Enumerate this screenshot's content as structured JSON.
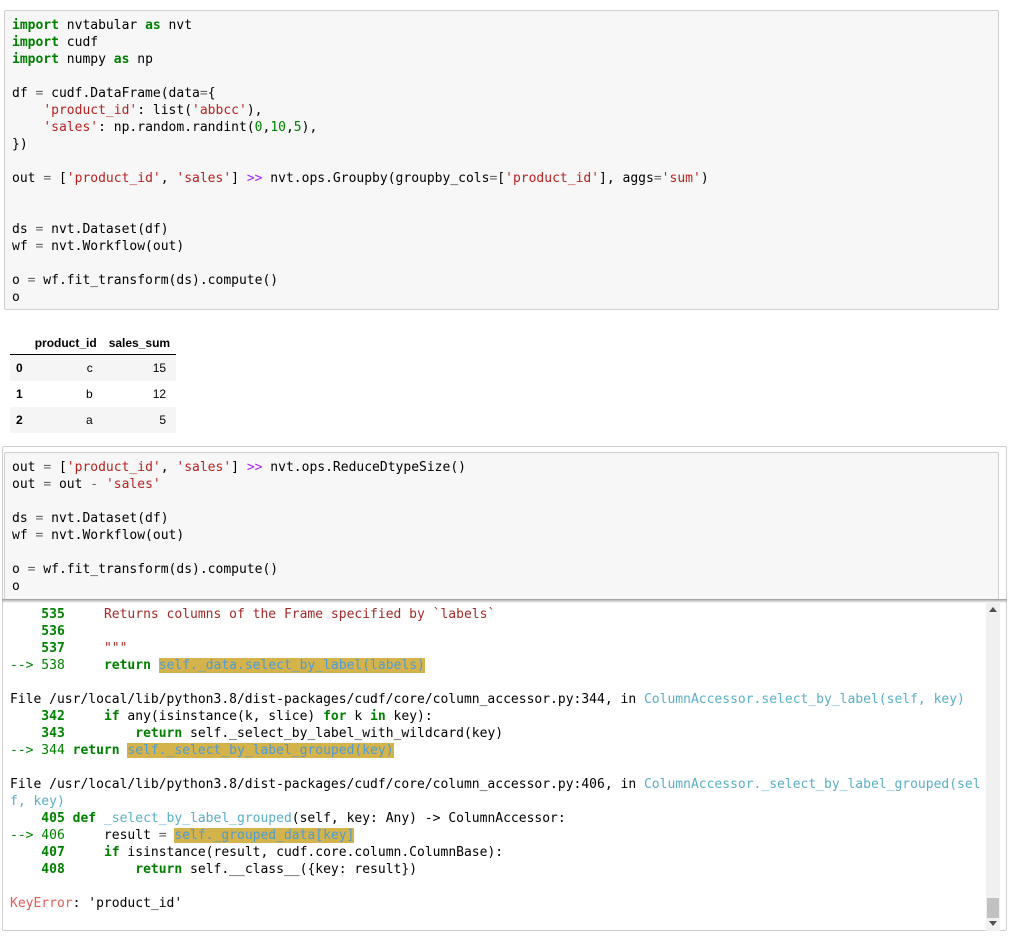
{
  "cell1": {
    "lines": [
      [
        [
          "kw",
          "import"
        ],
        [
          "t",
          " nvtabular "
        ],
        [
          "kw",
          "as"
        ],
        [
          "t",
          " nvt"
        ]
      ],
      [
        [
          "kw",
          "import"
        ],
        [
          "t",
          " cudf"
        ]
      ],
      [
        [
          "kw",
          "import"
        ],
        [
          "t",
          " numpy "
        ],
        [
          "kw",
          "as"
        ],
        [
          "t",
          " np"
        ]
      ],
      [],
      [
        [
          "t",
          "df "
        ],
        [
          "eq",
          "="
        ],
        [
          "t",
          " cudf.DataFrame(data"
        ],
        [
          "eq",
          "="
        ],
        [
          "t",
          "{"
        ]
      ],
      [
        [
          "t",
          "    "
        ],
        [
          "str",
          "'product_id'"
        ],
        [
          "t",
          ": list("
        ],
        [
          "str",
          "'abbcc'"
        ],
        [
          "t",
          "),"
        ]
      ],
      [
        [
          "t",
          "    "
        ],
        [
          "str",
          "'sales'"
        ],
        [
          "t",
          ": np.random.randint("
        ],
        [
          "num",
          "0"
        ],
        [
          "t",
          ","
        ],
        [
          "num",
          "10"
        ],
        [
          "t",
          ","
        ],
        [
          "num",
          "5"
        ],
        [
          "t",
          "),"
        ]
      ],
      [
        [
          "t",
          "})"
        ]
      ],
      [],
      [
        [
          "t",
          "out "
        ],
        [
          "eq",
          "="
        ],
        [
          "t",
          " ["
        ],
        [
          "str",
          "'product_id'"
        ],
        [
          "t",
          ", "
        ],
        [
          "str",
          "'sales'"
        ],
        [
          "t",
          "] "
        ],
        [
          "op",
          ">>"
        ],
        [
          "t",
          " nvt.ops.Groupby(groupby_cols"
        ],
        [
          "eq",
          "="
        ],
        [
          "t",
          "["
        ],
        [
          "str",
          "'product_id'"
        ],
        [
          "t",
          "], aggs"
        ],
        [
          "eq",
          "="
        ],
        [
          "str",
          "'sum'"
        ],
        [
          "t",
          ")"
        ]
      ],
      [],
      [],
      [
        [
          "t",
          "ds "
        ],
        [
          "eq",
          "="
        ],
        [
          "t",
          " nvt.Dataset(df)"
        ]
      ],
      [
        [
          "t",
          "wf "
        ],
        [
          "eq",
          "="
        ],
        [
          "t",
          " nvt.Workflow(out)"
        ]
      ],
      [],
      [
        [
          "t",
          "o "
        ],
        [
          "eq",
          "="
        ],
        [
          "t",
          " wf.fit_transform(ds).compute()"
        ]
      ],
      [
        [
          "t",
          "o"
        ]
      ]
    ]
  },
  "output_table": {
    "columns": [
      "product_id",
      "sales_sum"
    ],
    "rows": [
      {
        "index": "0",
        "product_id": "c",
        "sales_sum": "15"
      },
      {
        "index": "1",
        "product_id": "b",
        "sales_sum": "12"
      },
      {
        "index": "2",
        "product_id": "a",
        "sales_sum": "5"
      }
    ]
  },
  "cell2": {
    "lines": [
      [
        [
          "t",
          "out "
        ],
        [
          "eq",
          "="
        ],
        [
          "t",
          " ["
        ],
        [
          "str",
          "'product_id'"
        ],
        [
          "t",
          ", "
        ],
        [
          "str",
          "'sales'"
        ],
        [
          "t",
          "] "
        ],
        [
          "op",
          ">>"
        ],
        [
          "t",
          " nvt.ops.ReduceDtypeSize()"
        ]
      ],
      [
        [
          "t",
          "out "
        ],
        [
          "eq",
          "="
        ],
        [
          "t",
          " out "
        ],
        [
          "eq",
          "-"
        ],
        [
          "t",
          " "
        ],
        [
          "str",
          "'sales'"
        ]
      ],
      [],
      [
        [
          "t",
          "ds "
        ],
        [
          "eq",
          "="
        ],
        [
          "t",
          " nvt.Dataset(df)"
        ]
      ],
      [
        [
          "t",
          "wf "
        ],
        [
          "eq",
          "="
        ],
        [
          "t",
          " nvt.Workflow(out)"
        ]
      ],
      [],
      [
        [
          "t",
          "o "
        ],
        [
          "eq",
          "="
        ],
        [
          "t",
          " wf.fit_transform(ds).compute()"
        ]
      ],
      [
        [
          "t",
          "o"
        ]
      ]
    ]
  },
  "traceback": {
    "lines": [
      [
        [
          "ln",
          "    535"
        ],
        [
          "t",
          "     "
        ],
        [
          "tbstr",
          "Returns columns of the Frame specified by `labels`"
        ]
      ],
      [
        [
          "ln",
          "    536"
        ]
      ],
      [
        [
          "ln",
          "    537"
        ],
        [
          "t",
          "     "
        ],
        [
          "tbstr",
          "\"\"\""
        ]
      ],
      [
        [
          "arrow",
          "--> 538"
        ],
        [
          "t",
          "     "
        ],
        [
          "tbkw",
          "return"
        ],
        [
          "t",
          " "
        ],
        [
          "hl",
          "self._data.select_by_label(labels)"
        ]
      ],
      [],
      [
        [
          "t",
          "File "
        ],
        [
          "path",
          "/usr/local/lib/python3.8/dist-packages/cudf/core/column_accessor.py:344"
        ],
        [
          "t",
          ", in "
        ],
        [
          "fn",
          "ColumnAccessor.select_by_label(self, key)"
        ]
      ],
      [
        [
          "ln",
          "    342"
        ],
        [
          "t",
          "     "
        ],
        [
          "tbkw",
          "if"
        ],
        [
          "t",
          " any(isinstance(k, slice) "
        ],
        [
          "tbkw",
          "for"
        ],
        [
          "t",
          " k "
        ],
        [
          "tbkw",
          "in"
        ],
        [
          "t",
          " key):"
        ]
      ],
      [
        [
          "ln",
          "    343"
        ],
        [
          "t",
          "         "
        ],
        [
          "tbkw",
          "return"
        ],
        [
          "t",
          " self._select_by_label_with_wildcard(key)"
        ]
      ],
      [
        [
          "arrow",
          "--> 344"
        ],
        [
          "t",
          " "
        ],
        [
          "tbkw",
          "return"
        ],
        [
          "t",
          " "
        ],
        [
          "hl",
          "self._select_by_label_grouped(key)"
        ]
      ],
      [],
      [
        [
          "t",
          "File "
        ],
        [
          "path",
          "/usr/local/lib/python3.8/dist-packages/cudf/core/column_accessor.py:406"
        ],
        [
          "t",
          ", in "
        ],
        [
          "fn",
          "ColumnAccessor._select_by_label_grouped(sel"
        ]
      ],
      [
        [
          "fn",
          "f, key)"
        ]
      ],
      [
        [
          "ln",
          "    405"
        ],
        [
          "t",
          " "
        ],
        [
          "tbkw",
          "def"
        ],
        [
          "t",
          " "
        ],
        [
          "fn",
          "_select_by_label_grouped"
        ],
        [
          "t",
          "(self, key: Any) -> ColumnAccessor:"
        ]
      ],
      [
        [
          "arrow",
          "--> 406"
        ],
        [
          "t",
          "     result "
        ],
        [
          "eq",
          "="
        ],
        [
          "t",
          " "
        ],
        [
          "hl",
          "self._grouped_data[key]"
        ]
      ],
      [
        [
          "ln",
          "    407"
        ],
        [
          "t",
          "     "
        ],
        [
          "tbkw",
          "if"
        ],
        [
          "t",
          " isinstance(result, cudf.core.column.ColumnBase):"
        ]
      ],
      [
        [
          "ln",
          "    408"
        ],
        [
          "t",
          "         "
        ],
        [
          "tbkw",
          "return"
        ],
        [
          "t",
          " self.__class__({key: result})"
        ]
      ],
      [],
      [
        [
          "err",
          "KeyError"
        ],
        [
          "t",
          ": 'product_id'"
        ]
      ]
    ]
  }
}
